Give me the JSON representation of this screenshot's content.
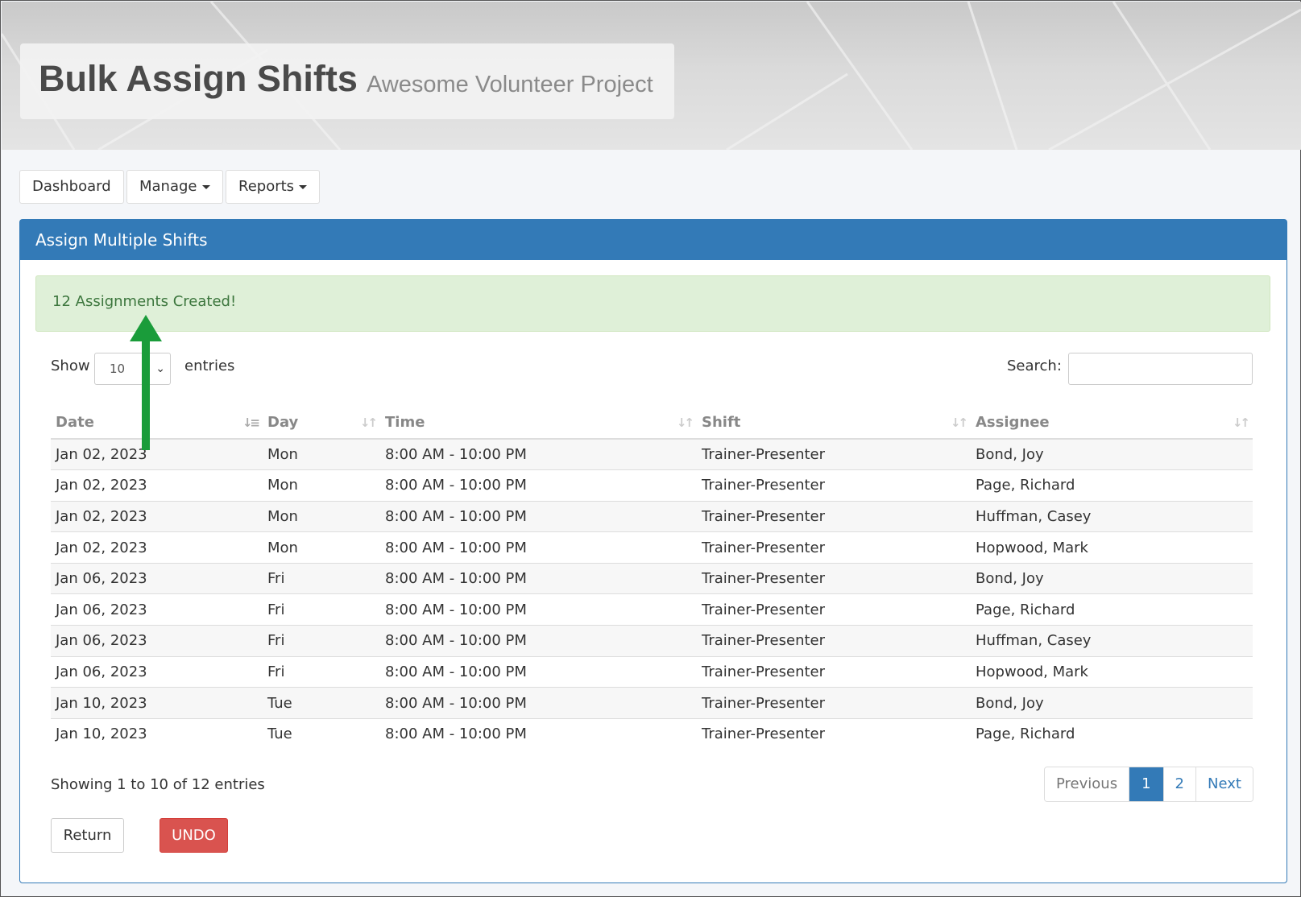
{
  "header": {
    "title": "Bulk Assign Shifts",
    "subtitle": "Awesome Volunteer Project"
  },
  "nav": {
    "dashboard": "Dashboard",
    "manage": "Manage",
    "reports": "Reports"
  },
  "panel": {
    "title": "Assign Multiple Shifts",
    "alert": "12 Assignments Created!",
    "show_label": "Show",
    "page_length": "10",
    "entries_label": "entries",
    "search_label": "Search:",
    "search_value": ""
  },
  "table": {
    "columns": [
      "Date",
      "Day",
      "Time",
      "Shift",
      "Assignee"
    ],
    "rows": [
      [
        "Jan 02, 2023",
        "Mon",
        "8:00 AM - 10:00 PM",
        "Trainer-Presenter",
        "Bond, Joy"
      ],
      [
        "Jan 02, 2023",
        "Mon",
        "8:00 AM - 10:00 PM",
        "Trainer-Presenter",
        "Page, Richard"
      ],
      [
        "Jan 02, 2023",
        "Mon",
        "8:00 AM - 10:00 PM",
        "Trainer-Presenter",
        "Huffman, Casey"
      ],
      [
        "Jan 02, 2023",
        "Mon",
        "8:00 AM - 10:00 PM",
        "Trainer-Presenter",
        "Hopwood, Mark"
      ],
      [
        "Jan 06, 2023",
        "Fri",
        "8:00 AM - 10:00 PM",
        "Trainer-Presenter",
        "Bond, Joy"
      ],
      [
        "Jan 06, 2023",
        "Fri",
        "8:00 AM - 10:00 PM",
        "Trainer-Presenter",
        "Page, Richard"
      ],
      [
        "Jan 06, 2023",
        "Fri",
        "8:00 AM - 10:00 PM",
        "Trainer-Presenter",
        "Huffman, Casey"
      ],
      [
        "Jan 06, 2023",
        "Fri",
        "8:00 AM - 10:00 PM",
        "Trainer-Presenter",
        "Hopwood, Mark"
      ],
      [
        "Jan 10, 2023",
        "Tue",
        "8:00 AM - 10:00 PM",
        "Trainer-Presenter",
        "Bond, Joy"
      ],
      [
        "Jan 10, 2023",
        "Tue",
        "8:00 AM - 10:00 PM",
        "Trainer-Presenter",
        "Page, Richard"
      ]
    ],
    "info": "Showing 1 to 10 of 12 entries"
  },
  "pagination": {
    "previous": "Previous",
    "page1": "1",
    "page2": "2",
    "next": "Next"
  },
  "actions": {
    "return": "Return",
    "undo": "UNDO"
  },
  "colors": {
    "primary": "#337ab7",
    "success_bg": "#dff0d8",
    "success_text": "#3c763d",
    "danger": "#d9534f",
    "annotation_arrow": "#1a9c3a"
  },
  "icons": {
    "sort_active": "sort-ascending-icon",
    "sort": "sort-both-icon",
    "dropdown": "caret-down-icon",
    "select": "chevron-down-icon"
  }
}
